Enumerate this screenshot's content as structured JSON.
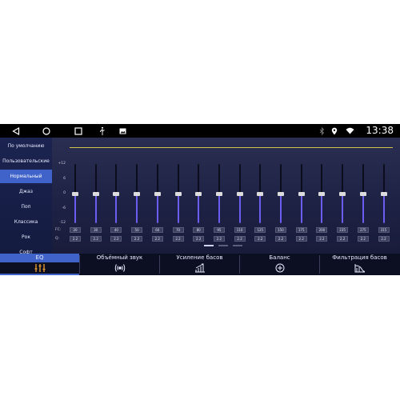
{
  "status_bar": {
    "nav": [
      {
        "icon": "back-triangle-icon"
      },
      {
        "icon": "home-circle-icon"
      },
      {
        "icon": "recents-square-icon"
      }
    ],
    "notifications": [
      {
        "icon": "usb-icon"
      },
      {
        "icon": "image-icon"
      }
    ],
    "system_icons": [
      {
        "icon": "bluetooth-icon"
      },
      {
        "icon": "location-pin-icon"
      },
      {
        "icon": "wifi-icon"
      }
    ],
    "time": "13:38"
  },
  "presets": {
    "selected_index": 2,
    "items": [
      {
        "label": "По умолчанию"
      },
      {
        "label": "Пользовательские"
      },
      {
        "label": "Нормальный"
      },
      {
        "label": "Джаз"
      },
      {
        "label": "Поп"
      },
      {
        "label": "Классика"
      },
      {
        "label": "Рок"
      },
      {
        "label": "Софт"
      }
    ]
  },
  "equalizer": {
    "scale": [
      {
        "label": "+12"
      },
      {
        "label": "6"
      },
      {
        "label": "0"
      },
      {
        "label": "-6"
      },
      {
        "label": "-12"
      }
    ],
    "gain_range": [
      -12,
      12
    ],
    "fc_label": "FC:",
    "q_label": "Q:",
    "bands": [
      {
        "fc": "20",
        "q": "2.2",
        "gain": 0
      },
      {
        "fc": "30",
        "q": "2.2",
        "gain": 0
      },
      {
        "fc": "40",
        "q": "2.2",
        "gain": 0
      },
      {
        "fc": "50",
        "q": "2.2",
        "gain": 0
      },
      {
        "fc": "60",
        "q": "2.2",
        "gain": 0
      },
      {
        "fc": "70",
        "q": "2.2",
        "gain": 0
      },
      {
        "fc": "80",
        "q": "2.2",
        "gain": 0
      },
      {
        "fc": "95",
        "q": "2.2",
        "gain": 0
      },
      {
        "fc": "110",
        "q": "2.2",
        "gain": 0
      },
      {
        "fc": "125",
        "q": "2.2",
        "gain": 0
      },
      {
        "fc": "150",
        "q": "2.2",
        "gain": 0
      },
      {
        "fc": "175",
        "q": "2.2",
        "gain": 0
      },
      {
        "fc": "200",
        "q": "2.2",
        "gain": 0
      },
      {
        "fc": "235",
        "q": "2.2",
        "gain": 0
      },
      {
        "fc": "275",
        "q": "2.2",
        "gain": 0
      },
      {
        "fc": "315",
        "q": "2.2",
        "gain": 0
      }
    ],
    "pages": {
      "count": 3,
      "current": 0
    }
  },
  "tabs": {
    "selected_index": 0,
    "items": [
      {
        "label": "EQ",
        "icon": "equalizer-icon"
      },
      {
        "label": "Объёмный звук",
        "icon": "surround-sound-icon"
      },
      {
        "label": "Усиление басов",
        "icon": "bass-boost-icon"
      },
      {
        "label": "Баланс",
        "icon": "balance-target-icon"
      },
      {
        "label": "Фильтрация басов",
        "icon": "bass-filter-icon"
      }
    ]
  },
  "colors": {
    "accent": "#3f63c9",
    "slider_fill": "#6a5df0",
    "curve": "#d2c44a",
    "tab_icon_active": "#f0a030",
    "tab_icon": "#e8ebff"
  }
}
